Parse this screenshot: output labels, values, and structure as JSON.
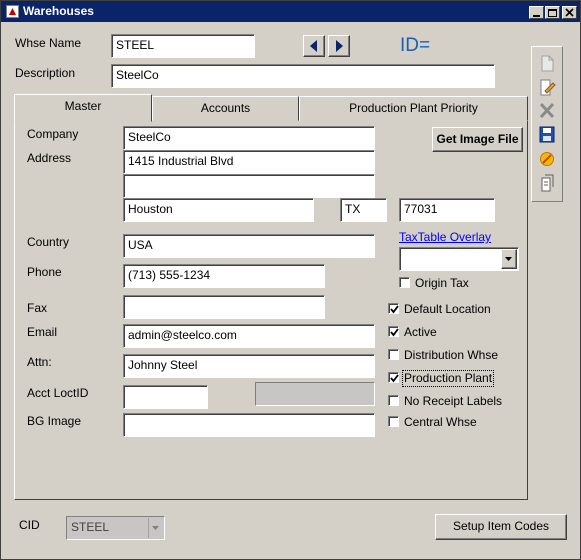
{
  "window": {
    "title": "Warehouses"
  },
  "header": {
    "whse_name_label": "Whse Name",
    "whse_name_value": "STEEL",
    "id_label": "ID=",
    "description_label": "Description",
    "description_value": "SteelCo"
  },
  "tabs": [
    {
      "label": "Master",
      "active": true
    },
    {
      "label": "Accounts",
      "active": false
    },
    {
      "label": "Production Plant Priority",
      "active": false
    }
  ],
  "master": {
    "company_label": "Company",
    "company_value": "SteelCo",
    "address_label": "Address",
    "address1": "1415 Industrial Blvd",
    "address2": "",
    "city": "Houston",
    "state": "TX",
    "zip": "77031",
    "country_label": "Country",
    "country_value": "USA",
    "phone_label": "Phone",
    "phone_value": "(713) 555-1234",
    "fax_label": "Fax",
    "fax_value": "",
    "email_label": "Email",
    "email_value": "admin@steelco.com",
    "attn_label": "Attn:",
    "attn_value": "Johnny Steel",
    "acct_loct_label": "Acct LoctID",
    "acct_loct_value": "",
    "bg_image_label": "BG Image",
    "bg_image_value": "",
    "get_image_button": "Get Image File",
    "taxtable_link": "TaxTable Overlay",
    "taxtable_value": "",
    "checkboxes": [
      {
        "label": "Origin Tax",
        "checked": false
      },
      {
        "label": "Default Location",
        "checked": true
      },
      {
        "label": "Active",
        "checked": true
      },
      {
        "label": "Distribution Whse",
        "checked": false
      },
      {
        "label": "Production Plant",
        "checked": true
      },
      {
        "label": "No Receipt Labels",
        "checked": false
      },
      {
        "label": "Central Whse",
        "checked": false
      }
    ]
  },
  "footer": {
    "cid_label": "CID",
    "cid_value": "STEEL",
    "setup_button": "Setup Item Codes"
  },
  "sidebar_icons": [
    "new-doc-icon",
    "edit-icon",
    "delete-icon",
    "save-icon",
    "cancel-icon",
    "copy-icon"
  ],
  "colors": {
    "titlebar": "#0a246a",
    "id_label": "#1a5fb4",
    "link": "#0000ff"
  }
}
